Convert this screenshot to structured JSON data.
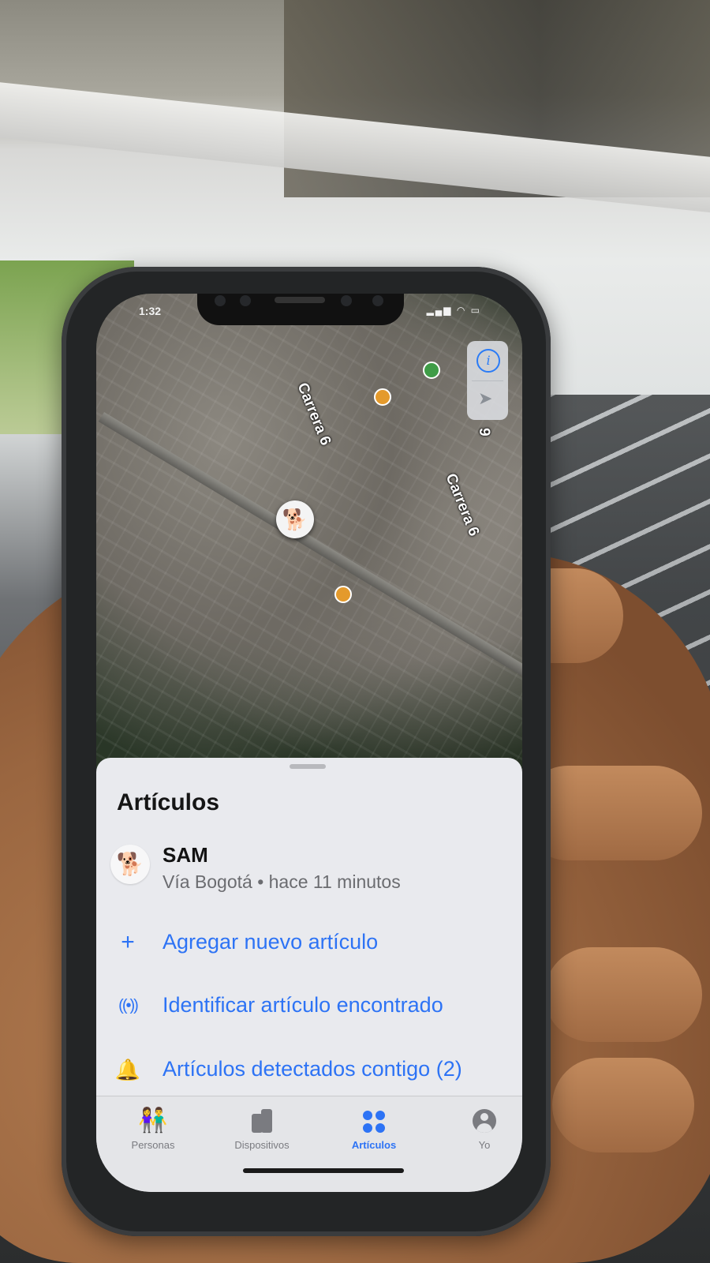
{
  "status_bar": {
    "time": "1:32",
    "icons": "▂▄▆ ◠ ▭"
  },
  "map": {
    "street_labels": [
      "Carrera 6",
      "Carrera 6",
      "9"
    ],
    "marker_icon": "dog-icon",
    "controls": {
      "info_icon": "info-icon",
      "locate_icon": "location-arrow-icon"
    }
  },
  "sheet": {
    "title": "Artículos",
    "item": {
      "icon": "dog-icon",
      "name": "SAM",
      "subtitle": "Vía Bogotá • hace 11 minutos"
    },
    "actions": [
      {
        "icon": "plus-icon",
        "label": "Agregar nuevo artículo"
      },
      {
        "icon": "airtag-signal-icon",
        "label": "Identificar artículo encontrado"
      },
      {
        "icon": "bell-icon",
        "label": "Artículos detectados contigo (2)"
      }
    ]
  },
  "tabbar": {
    "tabs": [
      {
        "label": "Personas",
        "icon": "people-icon"
      },
      {
        "label": "Dispositivos",
        "icon": "devices-icon"
      },
      {
        "label": "Artículos",
        "icon": "items-icon",
        "active": true
      },
      {
        "label": "Yo",
        "icon": "person-circle-icon"
      }
    ]
  },
  "colors": {
    "accent": "#2d73f5",
    "sheet_bg": "#e9eaee",
    "tab_inactive": "#7a7b80"
  }
}
